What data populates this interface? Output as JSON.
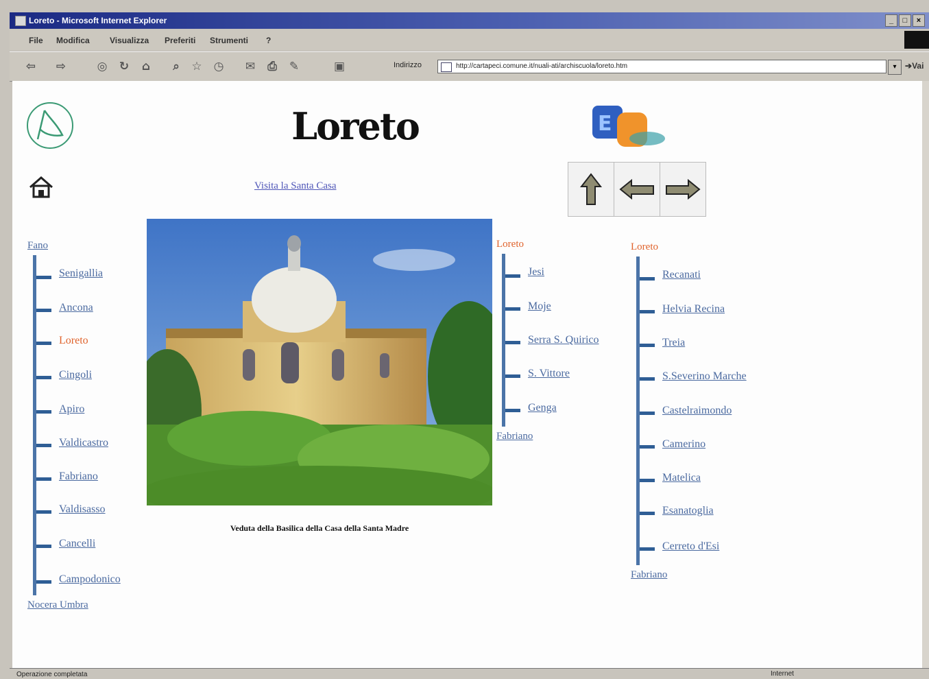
{
  "window": {
    "title": "Loreto - Microsoft Internet Explorer"
  },
  "menu": {
    "items": [
      "File",
      "Modifica",
      "Visualizza",
      "Preferiti",
      "Strumenti",
      "?"
    ]
  },
  "address": {
    "label": "Indirizzo",
    "url": "http://cartapeci.comune.it/nuali-ati/archiscuola/loreto.htm",
    "go": "Vai"
  },
  "status": {
    "text": "Operazione completata",
    "zone": "Internet"
  },
  "page": {
    "title": "Loreto",
    "visit_link": "Visita la Santa Casa",
    "caption": "Veduta della Basilica della Casa della Santa Madre",
    "nav_icons": [
      "up-arrow",
      "left-arrow",
      "right-arrow"
    ]
  },
  "tree_left": {
    "head": "Fano",
    "items": [
      "Senigallia",
      "Ancona",
      "Loreto",
      "Cingoli",
      "Apiro",
      "Valdicastro",
      "Fabriano",
      "Valdisasso",
      "Cancelli",
      "Campodonico"
    ],
    "current": 2,
    "tail": "Nocera Umbra"
  },
  "tree_mid": {
    "head": "Loreto",
    "items": [
      "Jesi",
      "Moje",
      "Serra S. Quirico",
      "S. Vittore",
      "Genga"
    ],
    "tail": "Fabriano"
  },
  "tree_right": {
    "head": "Loreto",
    "items": [
      "Recanati",
      "Helvia Recina",
      "Treia",
      "S.Severino Marche",
      "Castelraimondo",
      "Camerino",
      "Matelica",
      "Esanatoglia",
      "Cerreto d'Esi"
    ],
    "tail": "Fabriano"
  },
  "colors": {
    "title_bar": "#1b2a84",
    "link": "#4b6aa0",
    "current": "#e0632c",
    "tree_line": "#4b74a8"
  }
}
